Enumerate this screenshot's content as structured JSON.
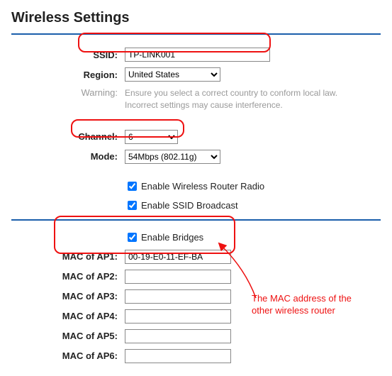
{
  "title": "Wireless Settings",
  "ssid": {
    "label": "SSID:",
    "value": "TP-LINK001"
  },
  "region": {
    "label": "Region:",
    "value": "United States",
    "options": [
      "United States"
    ]
  },
  "warning": {
    "label": "Warning:",
    "text": "Ensure you select a correct country to conform local law. Incorrect settings may cause interference."
  },
  "channel": {
    "label": "Channel:",
    "value": "6",
    "options": [
      "6"
    ]
  },
  "mode": {
    "label": "Mode:",
    "value": "54Mbps (802.11g)",
    "options": [
      "54Mbps (802.11g)"
    ]
  },
  "cb_radio": {
    "label": "Enable Wireless Router Radio",
    "checked": true
  },
  "cb_ssid": {
    "label": "Enable SSID Broadcast",
    "checked": true
  },
  "cb_bridges": {
    "label": "Enable Bridges",
    "checked": true
  },
  "aps": [
    {
      "label": "MAC of AP1:",
      "value": "00-19-E0-11-EF-BA"
    },
    {
      "label": "MAC of AP2:",
      "value": ""
    },
    {
      "label": "MAC of AP3:",
      "value": ""
    },
    {
      "label": "MAC of AP4:",
      "value": ""
    },
    {
      "label": "MAC of AP5:",
      "value": ""
    },
    {
      "label": "MAC of AP6:",
      "value": ""
    }
  ],
  "annotation": "The MAC address of the other wireless router"
}
